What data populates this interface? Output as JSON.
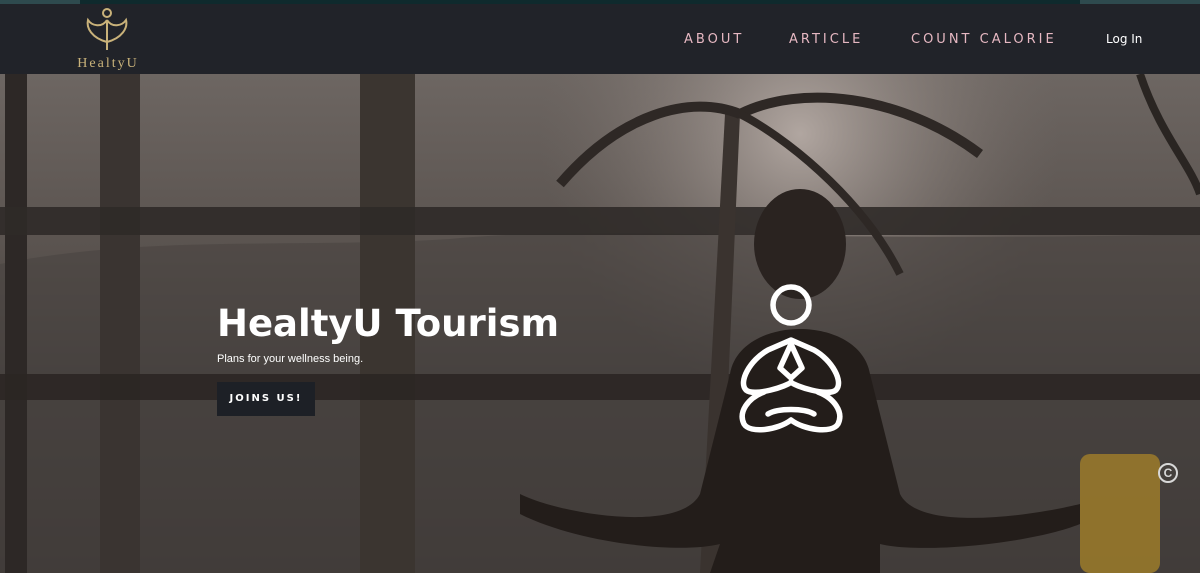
{
  "brand": {
    "name": "HealtyU",
    "logo_color": "#c9b27a"
  },
  "nav": {
    "items": [
      {
        "label": "ABOUT"
      },
      {
        "label": "ARTICLE"
      },
      {
        "label": "COUNT CALORIE"
      }
    ],
    "login_label": "Log In",
    "item_color": "#e6b8c2"
  },
  "hero": {
    "title": "HealtyU Tourism",
    "subtitle": "Plans for your wellness being.",
    "cta_label": "JOINS US!",
    "icon": "meditation-icon",
    "corner_icon": "copyright-icon",
    "corner_glyph": "C"
  },
  "colors": {
    "navbar_bg": "#212329",
    "button_bg": "#1d2026"
  }
}
